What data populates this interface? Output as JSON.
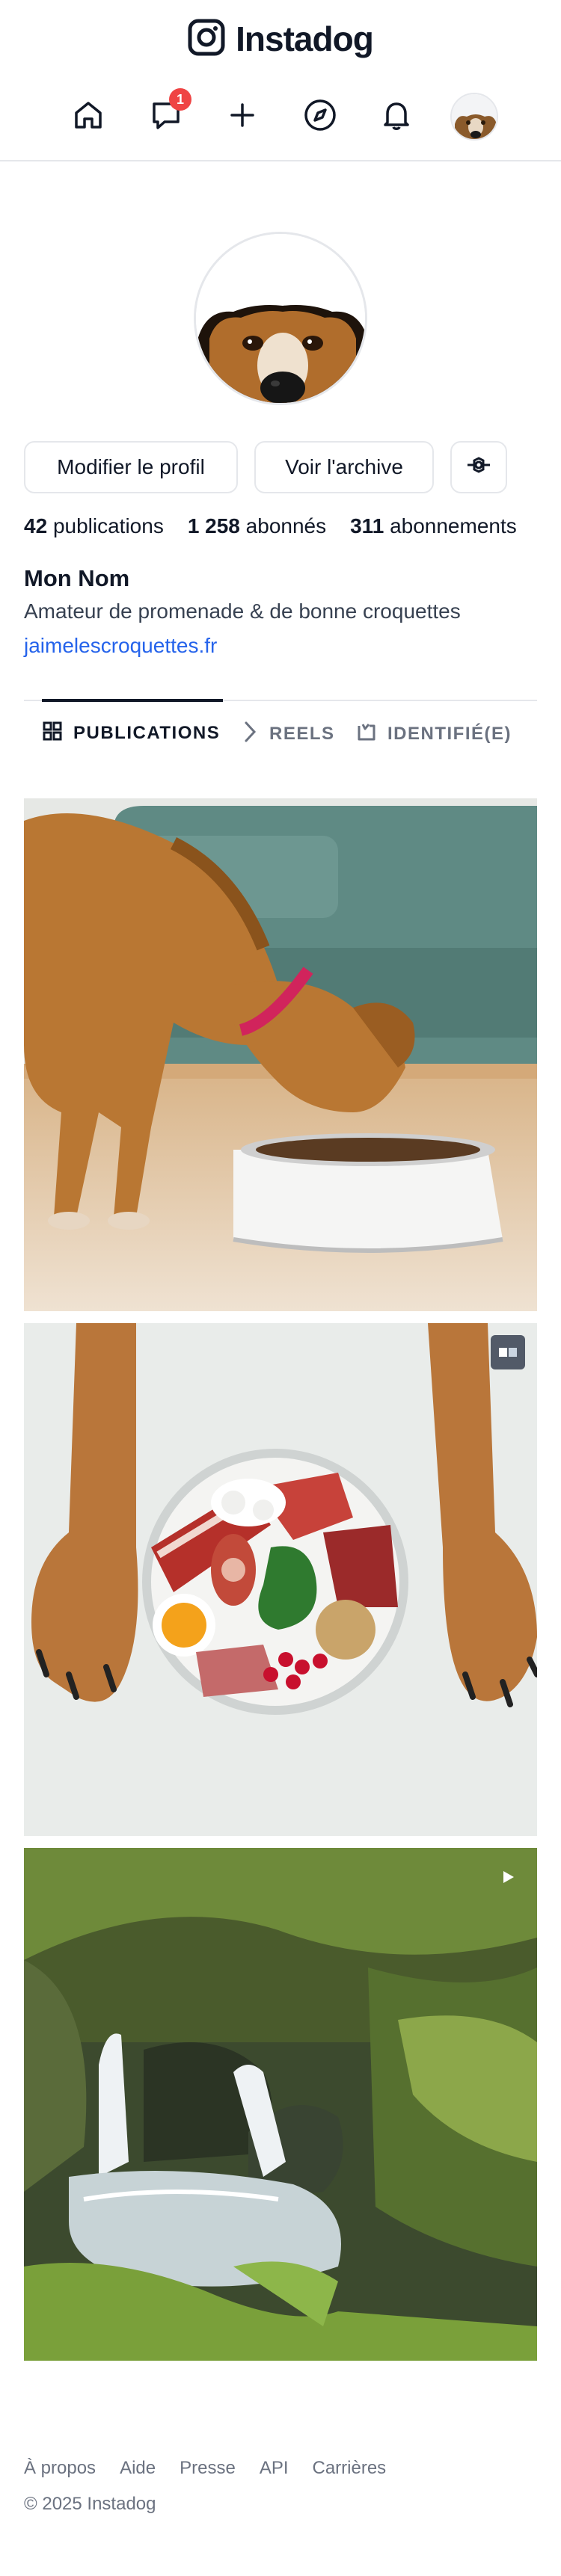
{
  "app": {
    "title": "Instadog"
  },
  "nav": {
    "messages_badge": "1",
    "items": [
      "home-icon",
      "messages-icon",
      "create-icon",
      "explore-icon",
      "notifications-icon",
      "profile-avatar"
    ]
  },
  "profile": {
    "edit_button": "Modifier le profil",
    "archive_button": "Voir l'archive",
    "settings_icon": "settings-icon",
    "stats": {
      "publications_count": "42",
      "publications_label": "publications",
      "followers_count": "1 258",
      "followers_label": "abonnés",
      "following_count": "311",
      "following_label": "abonnements"
    },
    "name": "Mon Nom",
    "bio": "Amateur de promenade & de bonne croquettes",
    "website": "jaimelescroquettes.fr"
  },
  "tabs": [
    {
      "label": "PUBLICATIONS",
      "icon": "grid-icon",
      "active": true
    },
    {
      "label": "REELS",
      "icon": "chevron-right-icon",
      "active": false
    },
    {
      "label": "IDENTIFIÉ(E)",
      "icon": "tag-icon",
      "active": false
    }
  ],
  "posts": [
    {
      "name": "post-dog-eating",
      "badge": null
    },
    {
      "name": "post-raw-food-plate",
      "badge": "carousel-icon"
    },
    {
      "name": "post-waterfall",
      "badge": "video-icon"
    }
  ],
  "footer": {
    "links": [
      "À propos",
      "Aide",
      "Presse",
      "API",
      "Carrières"
    ],
    "copyright": "© 2025 Instadog"
  },
  "colors": {
    "accent_link": "#2563eb",
    "badge": "#ef4444",
    "border": "#e5e7eb",
    "text": "#111827"
  }
}
